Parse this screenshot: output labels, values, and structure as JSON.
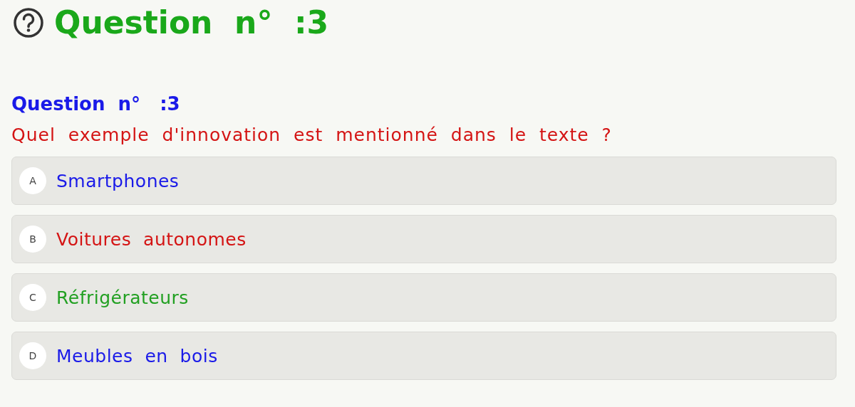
{
  "header": {
    "title": "Question  n°  :3"
  },
  "question": {
    "number": "Question  n°   :3",
    "text": "Quel  exemple  d'innovation  est  mentionné  dans  le  texte  ?"
  },
  "options": [
    {
      "letter": "A",
      "label": "Smartphones",
      "color": "#1a1ae8"
    },
    {
      "letter": "B",
      "label": "Voitures  autonomes",
      "color": "#d41414"
    },
    {
      "letter": "C",
      "label": "Réfrigérateurs",
      "color": "#22a022"
    },
    {
      "letter": "D",
      "label": "Meubles  en  bois",
      "color": "#1a1ae8"
    }
  ]
}
